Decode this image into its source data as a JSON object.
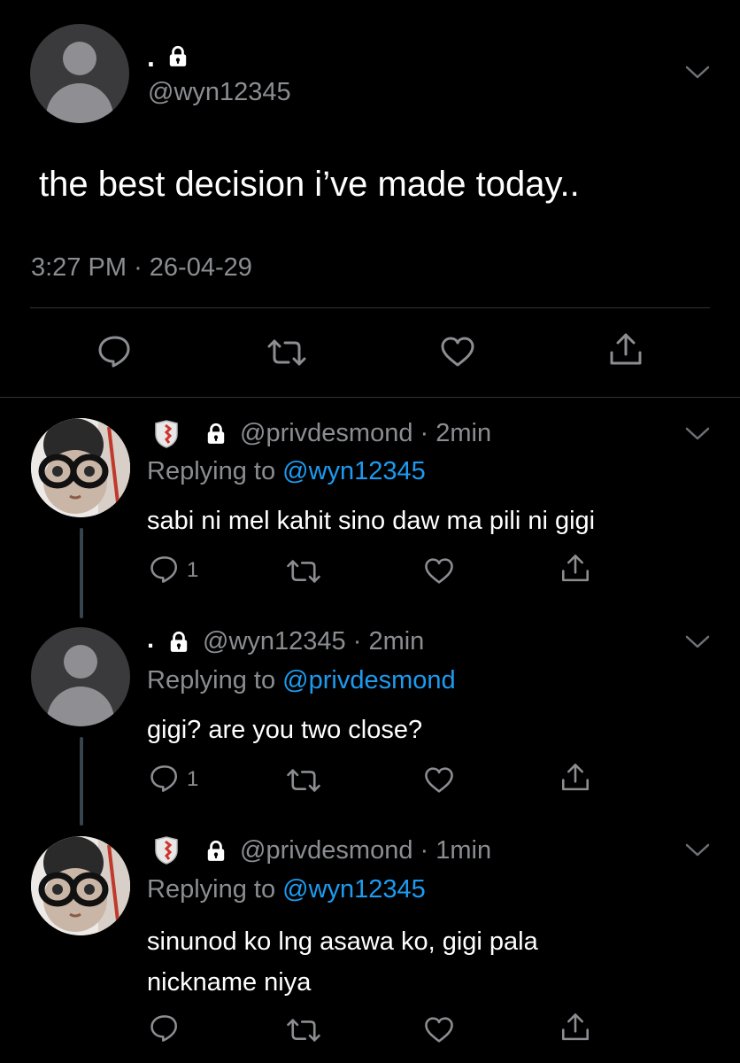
{
  "main_tweet": {
    "display_name": ".",
    "handle": "@wyn12345",
    "text": "the best decision i’ve made today..",
    "time": "3:27 PM",
    "separator": "·",
    "date": "26-04-29"
  },
  "replies": [
    {
      "handle": "@privdesmond",
      "time": "2min",
      "replying_prefix": "Replying to",
      "replying_to": "@wyn12345",
      "text_lines": [
        "sabi ni mel kahit sino daw ma pili ni gigi"
      ],
      "reply_count": "1"
    },
    {
      "display_name": ".",
      "handle": "@wyn12345",
      "time": "2min",
      "replying_prefix": "Replying to",
      "replying_to": "@privdesmond",
      "text_lines": [
        "gigi? are you two close?"
      ],
      "reply_count": "1"
    },
    {
      "handle": "@privdesmond",
      "time": "1min",
      "replying_prefix": "Replying to",
      "replying_to": "@wyn12345",
      "text_lines": [
        "sinunod ko lng asawa ko, gigi pala",
        "nickname niya"
      ],
      "reply_count": ""
    }
  ],
  "icons": {
    "reply": "speech-bubble-icon",
    "retweet": "retweet-icon",
    "like": "heart-icon",
    "share": "share-icon",
    "lock": "lock-icon",
    "more": "chevron-down-icon"
  },
  "colors": {
    "background": "#000000",
    "muted": "#8b8d91",
    "link": "#1d9bf0"
  }
}
